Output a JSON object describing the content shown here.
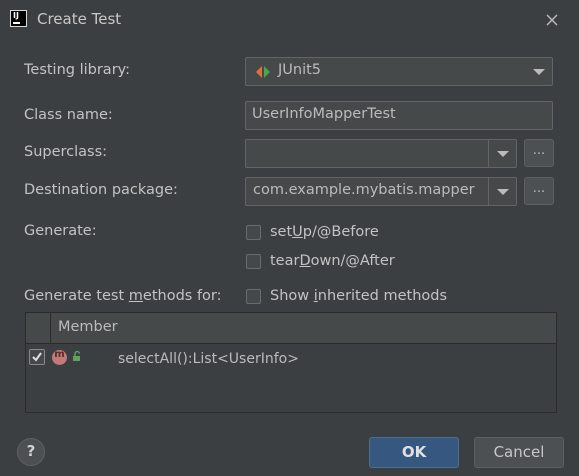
{
  "window": {
    "title": "Create Test"
  },
  "form": {
    "testing_library_label": "Testing library:",
    "testing_library_value": "JUnit5",
    "class_name_label": "Class name:",
    "class_name_value": "UserInfoMapperTest",
    "superclass_label": "Superclass:",
    "superclass_value": "",
    "superclass_browse": "...",
    "destination_label": "Destination package:",
    "destination_value": "com.example.mybatis.mapper",
    "destination_browse": "...",
    "generate_label": "Generate:",
    "setup_pre": "set",
    "setup_mn": "U",
    "setup_post": "p/@Before",
    "teardown_pre": "tear",
    "teardown_mn": "D",
    "teardown_post": "own/@After",
    "methods_label_pre": "Generate test ",
    "methods_label_mn": "m",
    "methods_label_post": "ethods for:",
    "inherited_pre": "Show ",
    "inherited_mn": "i",
    "inherited_post": "nherited methods"
  },
  "table": {
    "column_header": "Member",
    "rows": [
      {
        "checked": true,
        "icon": "method-icon",
        "badge": "m",
        "access": "public-lock-icon",
        "member": "selectAll():List<UserInfo>"
      }
    ]
  },
  "footer": {
    "help": "?",
    "ok_label": "OK",
    "cancel_label": "Cancel"
  },
  "colors": {
    "background": "#3c3f41",
    "ok_button": "#365880",
    "method_icon": "#c07a7a",
    "unlock_icon": "#5fa35f"
  }
}
